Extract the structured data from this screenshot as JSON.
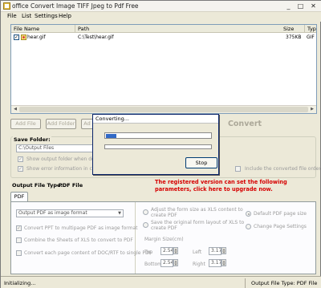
{
  "window": {
    "title": "office Convert Image TIFF Jpeg to Pdf Free"
  },
  "menu": [
    "File",
    "List",
    "Settings",
    "Help"
  ],
  "file_list": {
    "columns": [
      "File Name",
      "Path",
      "Size",
      "Type"
    ],
    "rows": [
      {
        "name": "hear.gif",
        "path": "C:\\Test\\hear.gif",
        "size": "375KB",
        "type": "GIF"
      }
    ]
  },
  "toolbar": {
    "add_file": "Add File",
    "add_folder": "Add Folder",
    "add_partial": "Ad",
    "convert": "Convert"
  },
  "save_folder": {
    "label": "Save Folder:",
    "path": "C:\\Output Files",
    "show_output": "Show output folder when done",
    "show_error": "Show error information in converting",
    "include_order": "Include the converted file order"
  },
  "promo": {
    "line1": "The registered version can set the following",
    "line2": "parameters, click here to upgrade now."
  },
  "output_type": {
    "label": "Output File Type:",
    "value": "PDF File"
  },
  "tab": "PDF",
  "options": {
    "select": "Output PDF as image format",
    "opt1": "Convert PPT to multipage PDF as image format",
    "opt2": "Combine the Sheets of XLS to convert to PDF",
    "opt3": "Convert each page content of DOC/RTF to single PDF",
    "adjust_xls": [
      "Adjust the form size as XLS content to",
      "create PDF"
    ],
    "save_layout": [
      "Save the original form layout of XLS to",
      "create PDF"
    ],
    "default_size": "Default PDF page size",
    "change_page": "Change Page Settings"
  },
  "margins": {
    "title": "Margin Size(cm)",
    "top": "Top",
    "top_val": "2.54",
    "left": "Left",
    "left_val": "3.17",
    "bottom": "Bottom",
    "bottom_val": "2.54",
    "right": "Right",
    "right_val": "3.17"
  },
  "dialog": {
    "title": "Converting...",
    "stop": "Stop",
    "progress1": 0.1,
    "progress2": 0.0
  },
  "status": {
    "left": "Initializing...",
    "right": "Output File Type:  PDF File"
  },
  "colors": {
    "promo": "#d60000",
    "progress": "#3169c6",
    "convert_text": "#aca899"
  }
}
